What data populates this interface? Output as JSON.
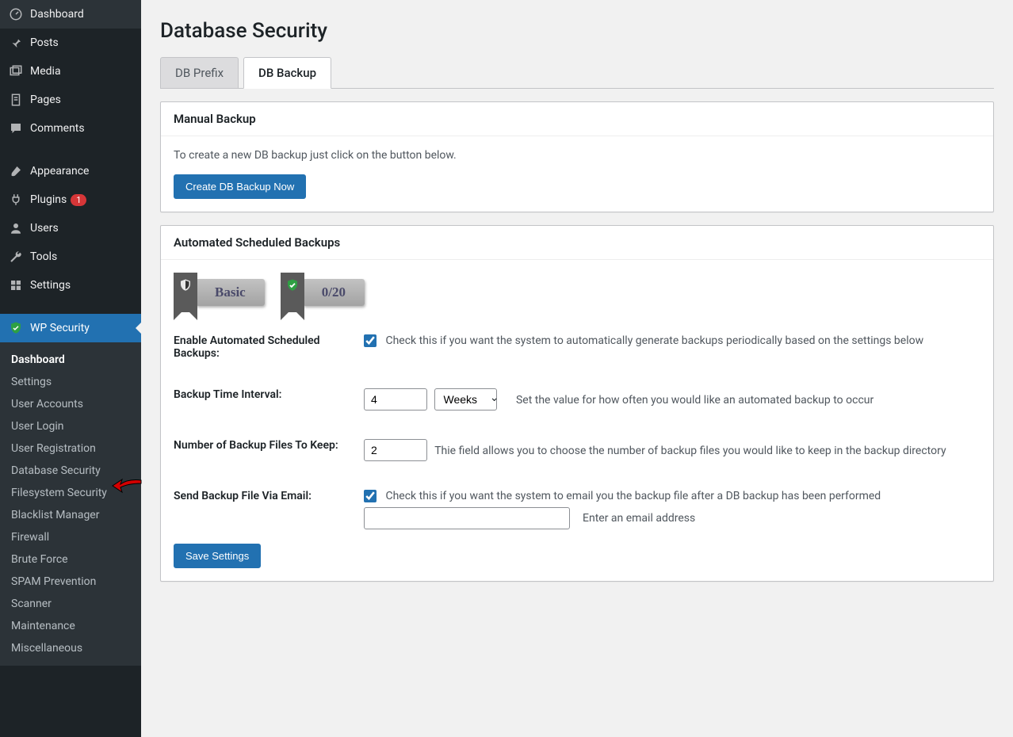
{
  "sidebar": {
    "main": [
      {
        "icon": "dashboard",
        "label": "Dashboard"
      },
      {
        "icon": "pin",
        "label": "Posts"
      },
      {
        "icon": "media",
        "label": "Media"
      },
      {
        "icon": "page",
        "label": "Pages"
      },
      {
        "icon": "comment",
        "label": "Comments"
      },
      {
        "icon": "brush",
        "label": "Appearance"
      },
      {
        "icon": "plug",
        "label": "Plugins",
        "badge": "1"
      },
      {
        "icon": "user",
        "label": "Users"
      },
      {
        "icon": "wrench",
        "label": "Tools"
      },
      {
        "icon": "settings",
        "label": "Settings"
      },
      {
        "icon": "shield",
        "label": "WP Security",
        "active": true
      }
    ],
    "sub": [
      "Dashboard",
      "Settings",
      "User Accounts",
      "User Login",
      "User Registration",
      "Database Security",
      "Filesystem Security",
      "Blacklist Manager",
      "Firewall",
      "Brute Force",
      "SPAM Prevention",
      "Scanner",
      "Maintenance",
      "Miscellaneous"
    ],
    "sub_current_index": 0,
    "sub_arrow_index": 5
  },
  "page": {
    "title": "Database Security"
  },
  "tabs": [
    {
      "label": "DB Prefix",
      "active": false
    },
    {
      "label": "DB Backup",
      "active": true
    }
  ],
  "card_manual": {
    "heading": "Manual Backup",
    "desc": "To create a new DB backup just click on the button below.",
    "button": "Create DB Backup Now"
  },
  "card_auto": {
    "heading": "Automated Scheduled Backups",
    "badge_basic": "Basic",
    "badge_score": "0/20",
    "rows": {
      "enable": {
        "label": "Enable Automated Scheduled Backups:",
        "checked": true,
        "desc": "Check this if you want the system to automatically generate backups periodically based on the settings below"
      },
      "interval": {
        "label": "Backup Time Interval:",
        "value": "4",
        "unit": "Weeks",
        "desc": "Set the value for how often you would like an automated backup to occur"
      },
      "keep": {
        "label": "Number of Backup Files To Keep:",
        "value": "2",
        "desc": "Thie field allows you to choose the number of backup files you would like to keep in the backup directory"
      },
      "email": {
        "label": "Send Backup File Via Email:",
        "checked": true,
        "desc": "Check this if you want the system to email you the backup file after a DB backup has been performed",
        "value": "",
        "placeholder": "Enter an email address"
      }
    },
    "save": "Save Settings"
  }
}
